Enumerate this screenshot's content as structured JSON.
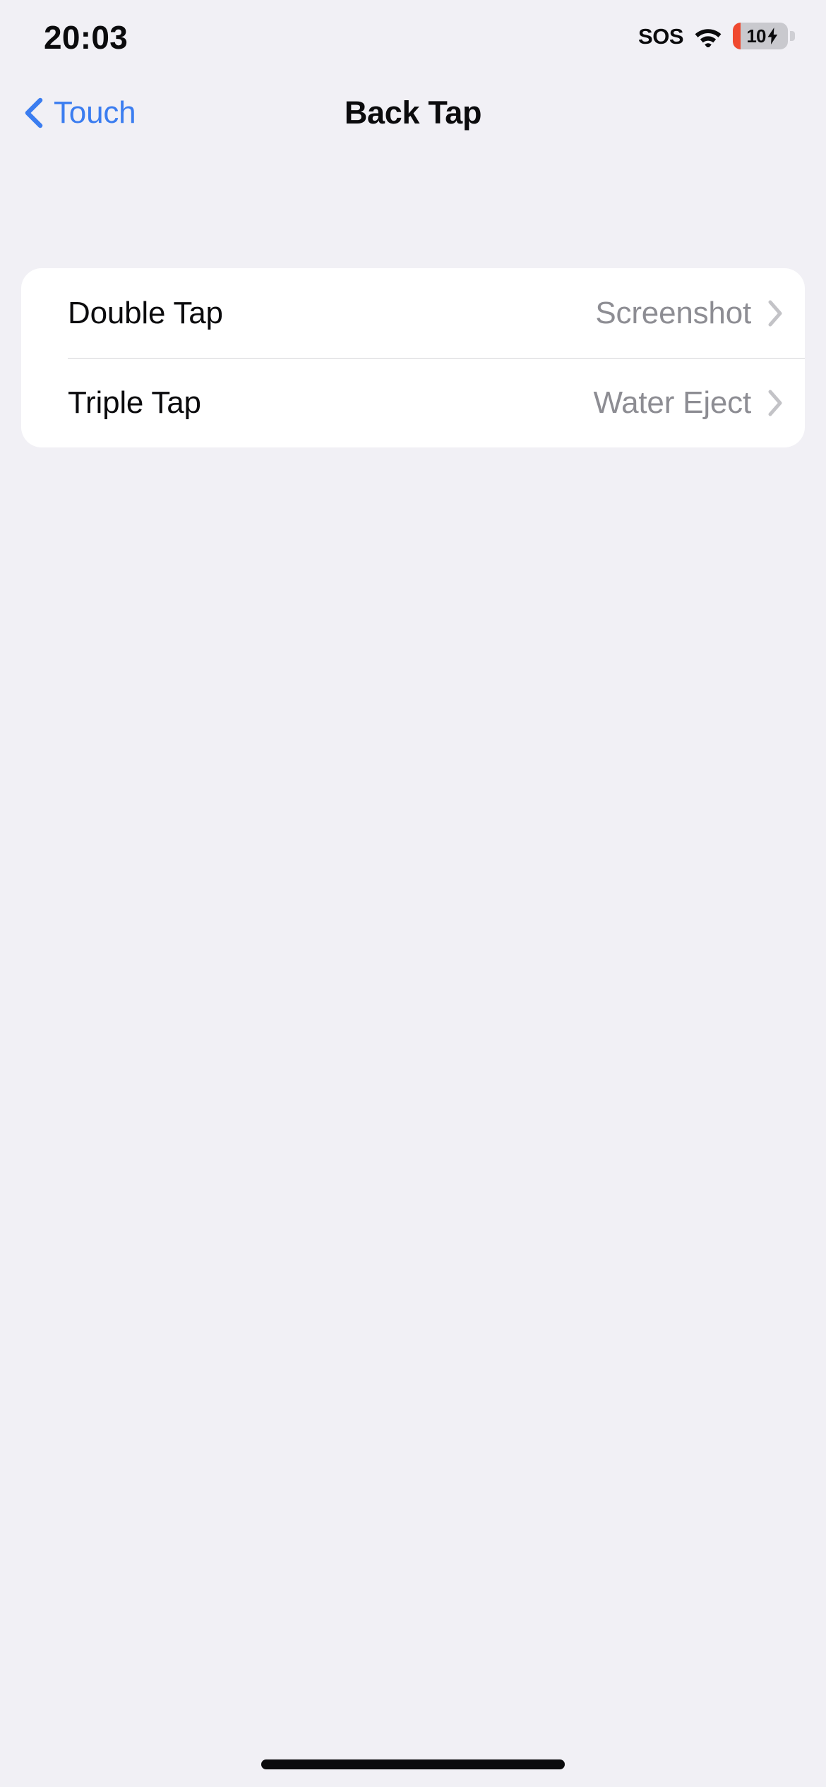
{
  "status_bar": {
    "time": "20:03",
    "sos_label": "SOS",
    "wifi_icon": "wifi-icon",
    "battery": {
      "percent_label": "10",
      "charging_icon": "lightning-bolt-icon",
      "level_color": "#f0492f",
      "body_color": "#c9c9ce"
    }
  },
  "nav": {
    "back_label": "Touch",
    "back_icon": "chevron-left-icon",
    "title": "Back Tap",
    "accent_color": "#3b7df0"
  },
  "settings": {
    "rows": [
      {
        "label": "Double Tap",
        "value": "Screenshot",
        "disclosure_icon": "chevron-right-icon"
      },
      {
        "label": "Triple Tap",
        "value": "Water Eject",
        "disclosure_icon": "chevron-right-icon"
      }
    ]
  },
  "colors": {
    "background": "#f1f0f5",
    "card": "#ffffff",
    "primary_text": "#0b0b0d",
    "secondary_text": "#8d8d93",
    "separator": "#d3d3d6"
  },
  "home_indicator": "home-indicator"
}
